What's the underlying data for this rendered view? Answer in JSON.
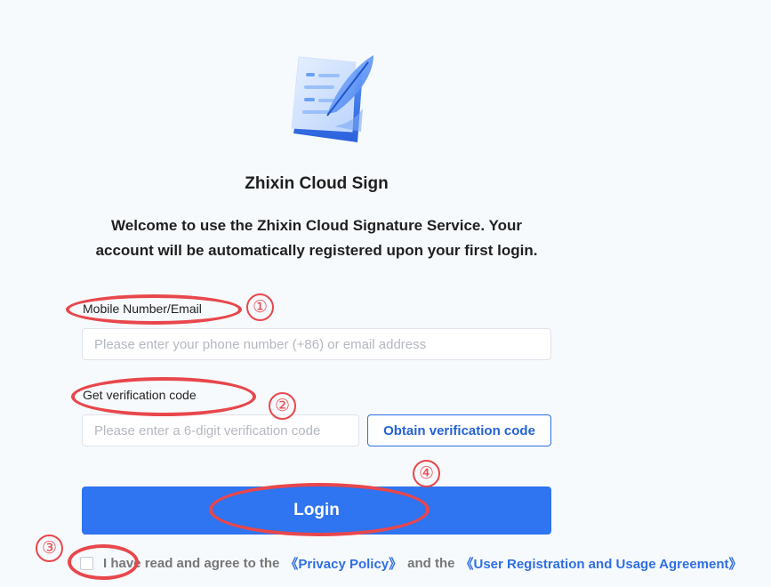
{
  "header": {
    "logo_icon": "document-quill-icon",
    "app_title": "Zhixin Cloud Sign",
    "welcome_text": "Welcome to use the Zhixin Cloud Signature Service. Your account will be automatically registered upon your first login."
  },
  "form": {
    "mobile_label": "Mobile Number/Email",
    "mobile_placeholder": "Please enter your phone number (+86) or email address",
    "mobile_value": "",
    "code_label": "Get verification code",
    "code_placeholder": "Please enter a 6-digit verification code",
    "code_value": "",
    "obtain_button": "Obtain verification code",
    "login_button": "Login"
  },
  "agreement": {
    "checked": false,
    "prefix": "I have read and agree to the",
    "privacy_link": "《Privacy Policy》",
    "and_text": "and the",
    "user_agreement_link": "《User Registration and Usage Agreement》"
  },
  "annotations": {
    "marker_1": "①",
    "marker_2": "②",
    "marker_3": "③",
    "marker_4": "④",
    "color": "#e8474c"
  },
  "colors": {
    "primary": "#2f74f0",
    "link": "#2f6fe2",
    "background": "#f7fafd"
  }
}
